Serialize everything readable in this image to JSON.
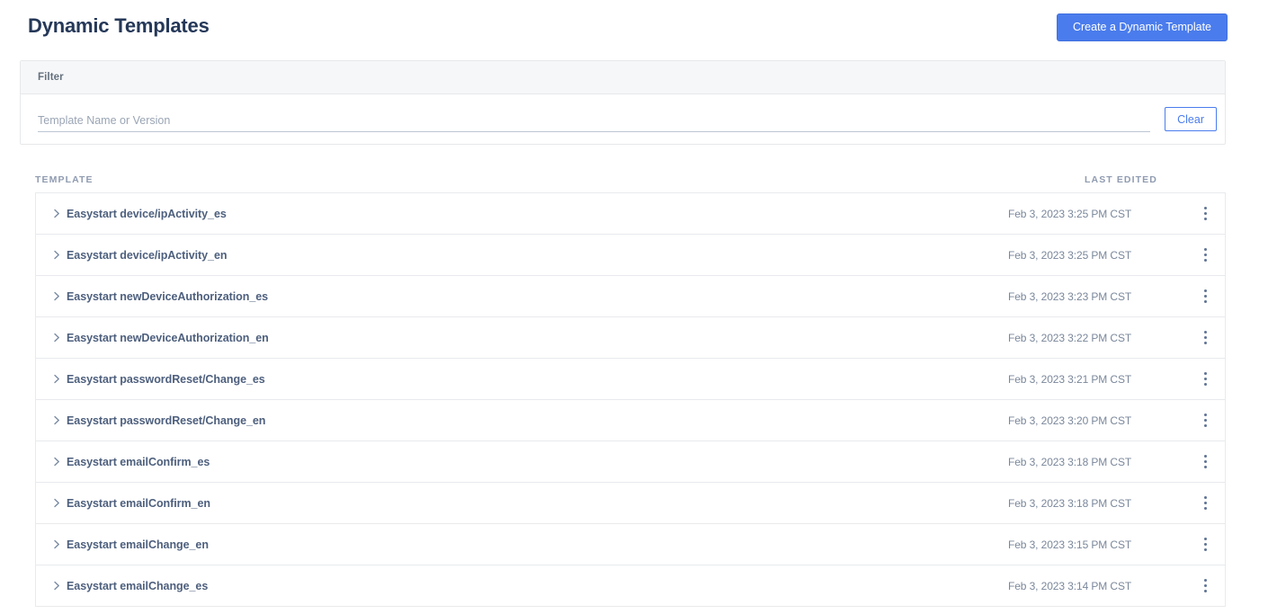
{
  "header": {
    "title": "Dynamic Templates",
    "create_button_label": "Create a Dynamic Template"
  },
  "filter": {
    "title": "Filter",
    "input_value": "",
    "input_placeholder": "Template Name or Version",
    "clear_button_label": "Clear"
  },
  "table": {
    "columns": {
      "template": "TEMPLATE",
      "last_edited": "LAST EDITED"
    },
    "rows": [
      {
        "name": "Easystart device/ipActivity_es",
        "last_edited": "Feb 3, 2023 3:25 PM CST"
      },
      {
        "name": "Easystart device/ipActivity_en",
        "last_edited": "Feb 3, 2023 3:25 PM CST"
      },
      {
        "name": "Easystart newDeviceAuthorization_es",
        "last_edited": "Feb 3, 2023 3:23 PM CST"
      },
      {
        "name": "Easystart newDeviceAuthorization_en",
        "last_edited": "Feb 3, 2023 3:22 PM CST"
      },
      {
        "name": "Easystart passwordReset/Change_es",
        "last_edited": "Feb 3, 2023 3:21 PM CST"
      },
      {
        "name": "Easystart passwordReset/Change_en",
        "last_edited": "Feb 3, 2023 3:20 PM CST"
      },
      {
        "name": "Easystart emailConfirm_es",
        "last_edited": "Feb 3, 2023 3:18 PM CST"
      },
      {
        "name": "Easystart emailConfirm_en",
        "last_edited": "Feb 3, 2023 3:18 PM CST"
      },
      {
        "name": "Easystart emailChange_en",
        "last_edited": "Feb 3, 2023 3:15 PM CST"
      },
      {
        "name": "Easystart emailChange_es",
        "last_edited": "Feb 3, 2023 3:14 PM CST"
      }
    ]
  },
  "icons": {
    "row_expand": "chevron-right-icon",
    "row_overflow": "kebab-menu-icon"
  },
  "colors": {
    "accent": "#4a7ced",
    "title": "#253858",
    "row_text": "#4d5f7d",
    "muted": "#8f9bb0",
    "panel_header_bg": "#f6f7f8",
    "border": "#e8eaed"
  }
}
